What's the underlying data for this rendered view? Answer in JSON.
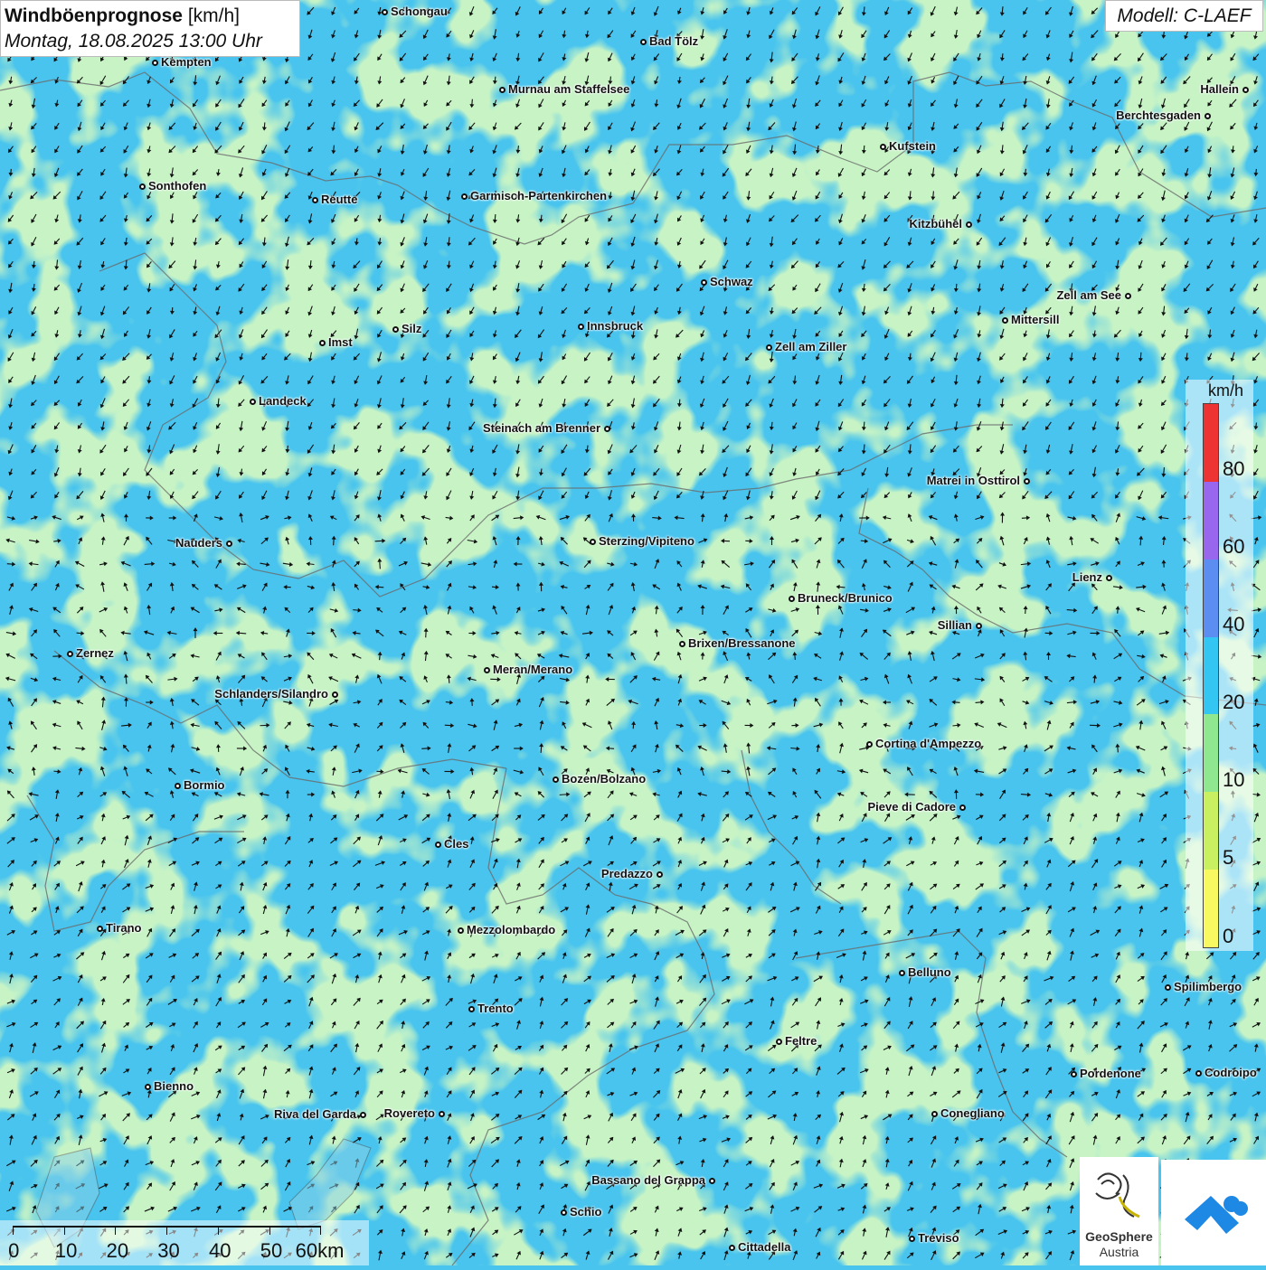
{
  "header": {
    "title_bold": "Windböenprognose",
    "title_unit": "[km/h]",
    "datetime": "Montag, 18.08.2025 13:00 Uhr",
    "model": "Modell: C-LAEF"
  },
  "legend": {
    "unit": "km/h",
    "labels": [
      "80",
      "60",
      "40",
      "20",
      "10",
      "5",
      "0"
    ],
    "colors": [
      "#ee3333",
      "#9966ee",
      "#5b8ef0",
      "#33c6f2",
      "#8fe88f",
      "#c8f060",
      "#f8f860"
    ]
  },
  "colors": {
    "calm_blue": "#48c4ee",
    "green": "#92e58e",
    "border": "#666666",
    "arrow": "#111111"
  },
  "cities": [
    "Schongau",
    "Bad Tölz",
    "Kempten",
    "Murnau am Staffelsee",
    "Hallein",
    "Berchtesgaden",
    "Kufstein",
    "Sonthofen",
    "Reutte",
    "Garmisch-Partenkirchen",
    "Kitzbühel",
    "Schwaz",
    "Zell am See",
    "Mittersill",
    "Innsbruck",
    "Silz",
    "Imst",
    "Zell am Ziller",
    "Landeck",
    "Steinach am Brenner",
    "Matrei in Osttirol",
    "Nauders",
    "Sterzing/Vipiteno",
    "Lienz",
    "Bruneck/Brunico",
    "Sillian",
    "Zernez",
    "Brixen/Bressanone",
    "Meran/Merano",
    "Schlanders/Silandro",
    "Cortina d'Ampezzo",
    "Bozen/Bolzano",
    "Bormio",
    "Pieve di Cadore",
    "Cles",
    "Predazzo",
    "Tirano",
    "Mezzolombardo",
    "Belluno",
    "Spilimbergo",
    "Trento",
    "Feltre",
    "Pordenone",
    "Codroipo",
    "Bienno",
    "Riva del Garda",
    "Rovereto",
    "Conegliano",
    "Bassano del Grappa",
    "Schio",
    "Treviso",
    "Cittadella"
  ],
  "scale": {
    "labels": [
      "0",
      "10",
      "20",
      "30",
      "40",
      "50",
      "60km"
    ]
  },
  "logos": {
    "geosphere_line1": "GeoSphere",
    "geosphere_line2": "Austria"
  }
}
